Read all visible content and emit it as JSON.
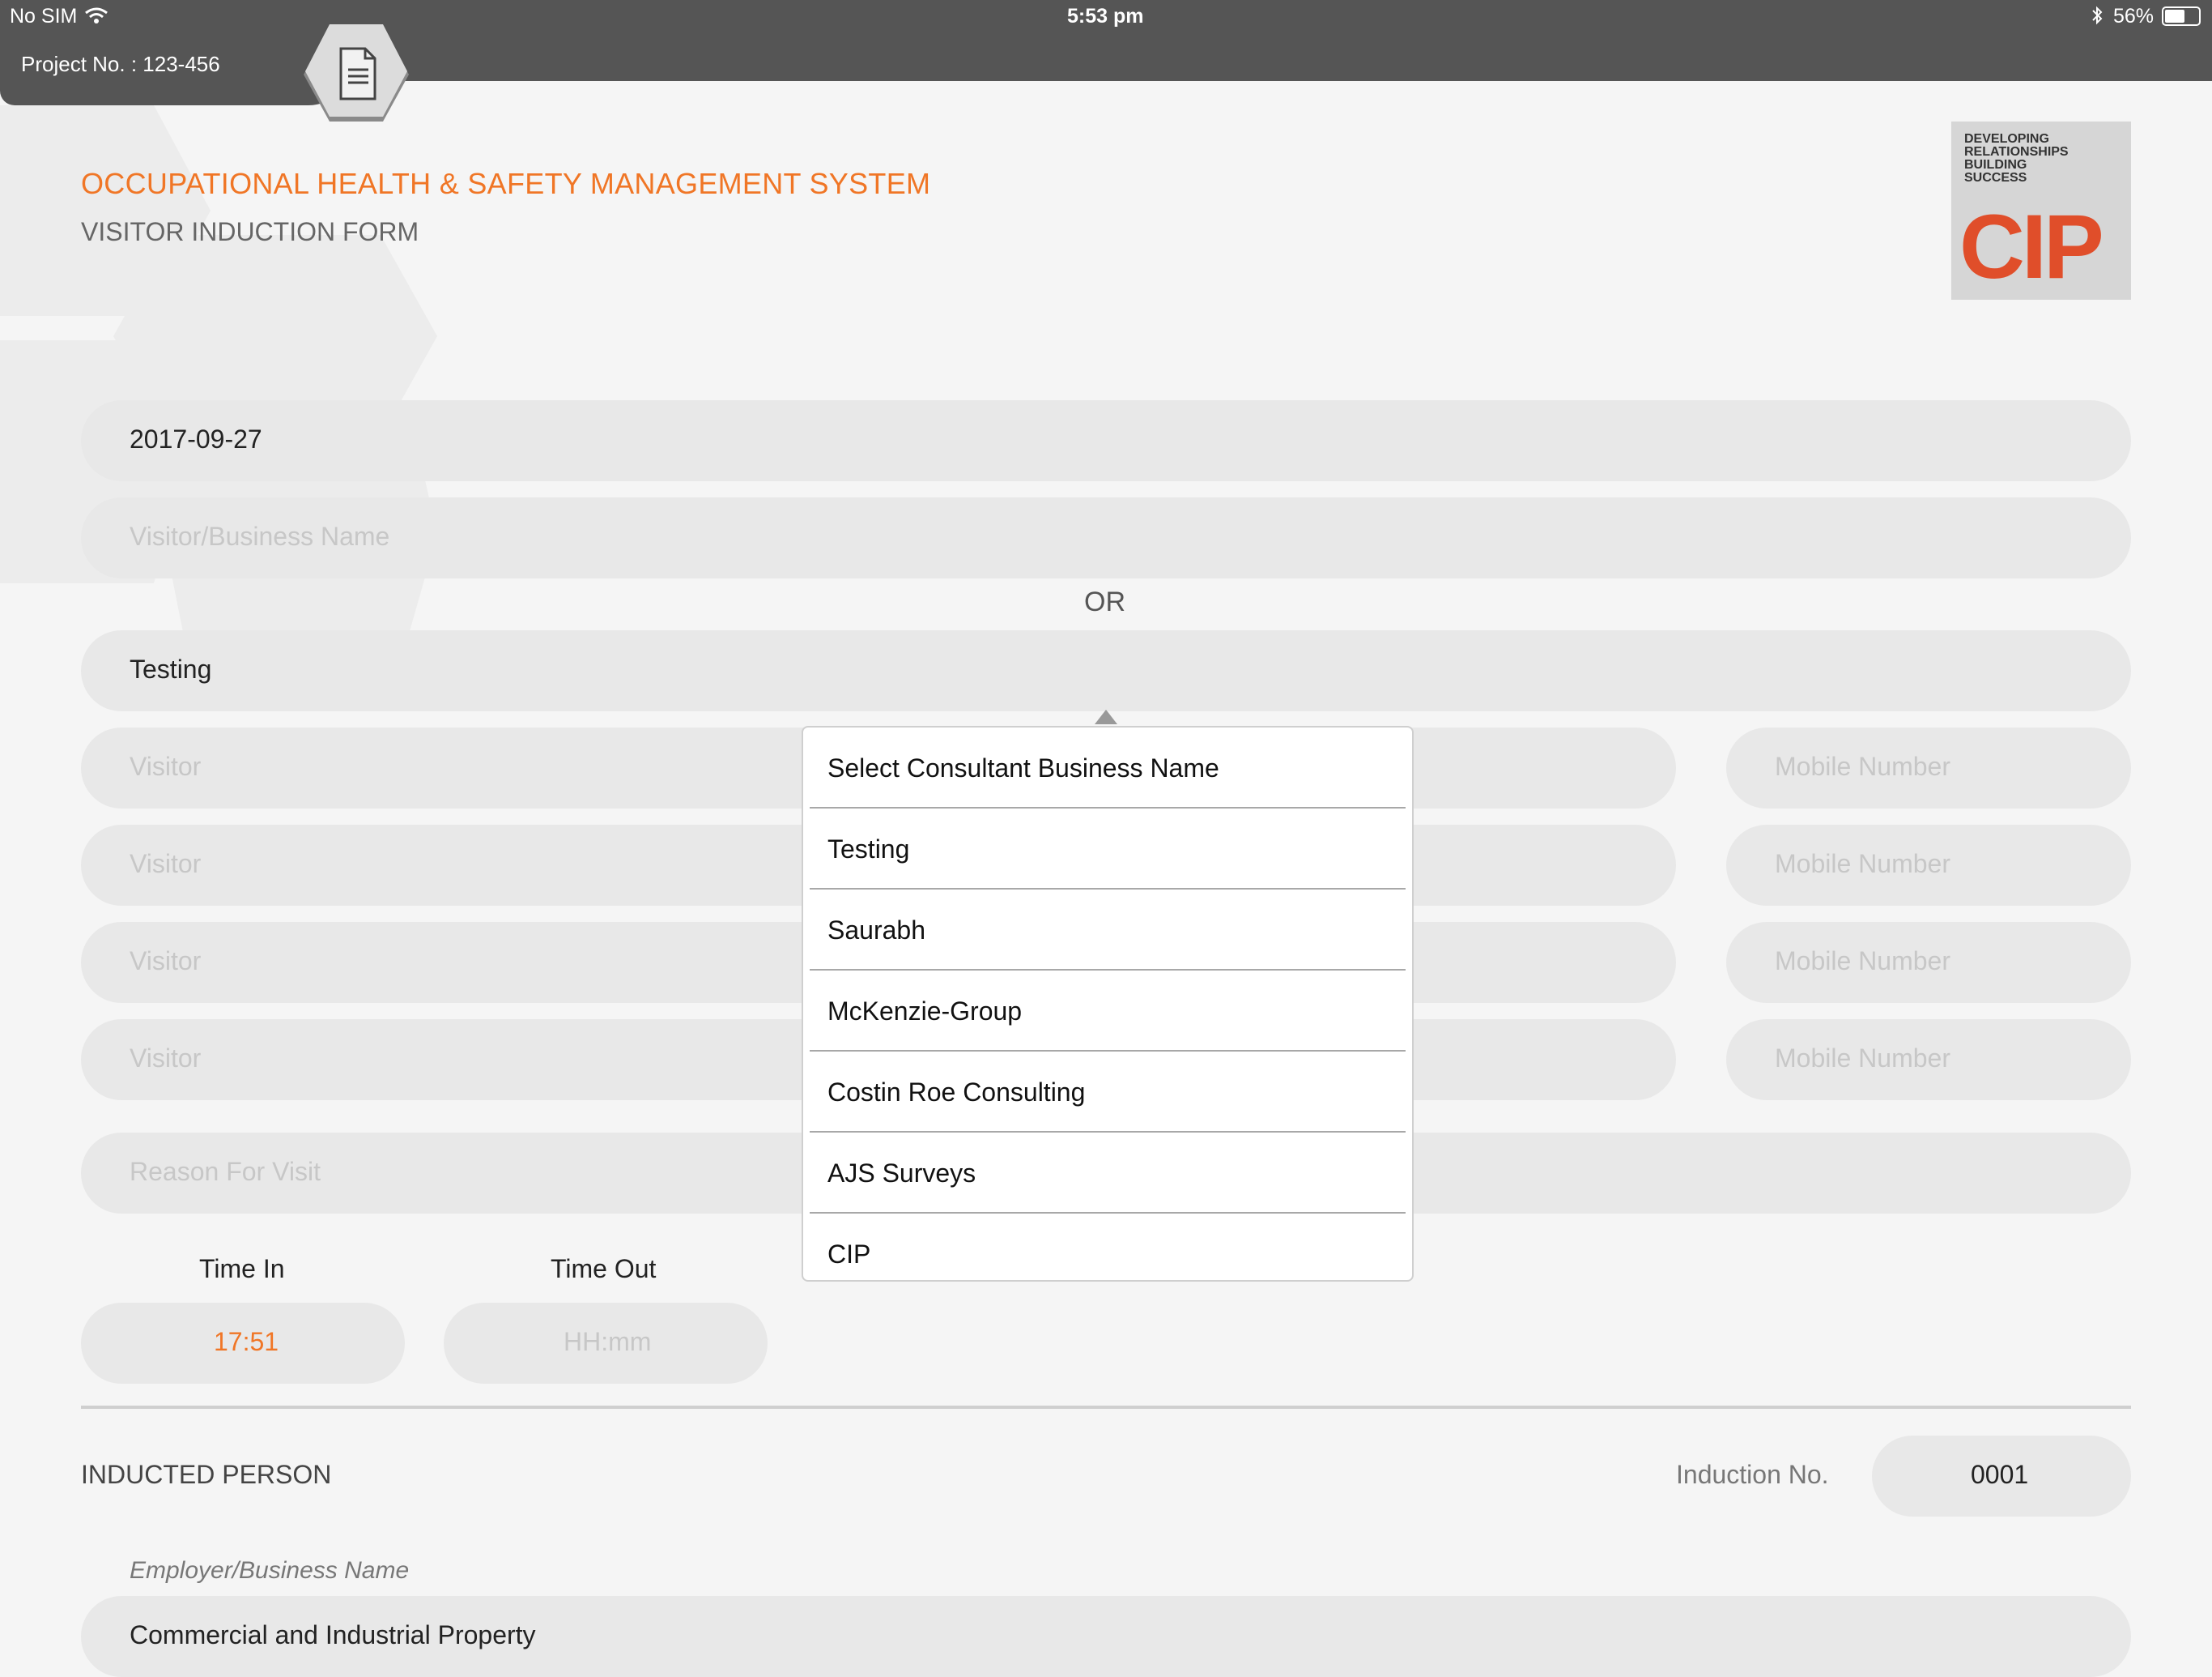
{
  "status_bar": {
    "carrier": "No SIM",
    "time": "5:53 pm",
    "battery": "56%",
    "icons": [
      "wifi-icon",
      "bluetooth-icon",
      "battery-icon"
    ]
  },
  "header": {
    "project_label": "Project No. : 123-456",
    "doc_icon": "document-icon"
  },
  "titles": {
    "main": "OCCUPATIONAL HEALTH & SAFETY MANAGEMENT SYSTEM",
    "sub": "VISITOR INDUCTION FORM"
  },
  "logo": {
    "tagline_1": "DEVELOPING",
    "tagline_2": "RELATIONSHIPS",
    "tagline_3": "BUILDING",
    "tagline_4": "SUCCESS",
    "brand": "CIP",
    "brand_color": "#e04e2a"
  },
  "form": {
    "date": "2017-09-27",
    "visitor_business_placeholder": "Visitor/Business Name",
    "or_label": "OR",
    "consultant_value": "Testing",
    "visitor_placeholder": "Visitor",
    "mobile_placeholder": "Mobile Number",
    "reason_placeholder": "Reason For Visit",
    "time_in_label": "Time In",
    "time_out_label": "Time Out",
    "time_in_value": "17:51",
    "time_out_placeholder": "HH:mm"
  },
  "inducted": {
    "section_label": "INDUCTED PERSON",
    "induction_no_label": "Induction No.",
    "induction_no_value": "0001",
    "employer_label": "Employer/Business Name",
    "employer_value": "Commercial and Industrial Property"
  },
  "dropdown": {
    "items": [
      "Select Consultant Business Name",
      "Testing",
      "Saurabh",
      "McKenzie-Group",
      "Costin Roe Consulting",
      "AJS Surveys",
      "CIP"
    ]
  },
  "colors": {
    "accent": "#f07626",
    "header_bg": "#555555",
    "field_bg": "#e8e8e8"
  }
}
